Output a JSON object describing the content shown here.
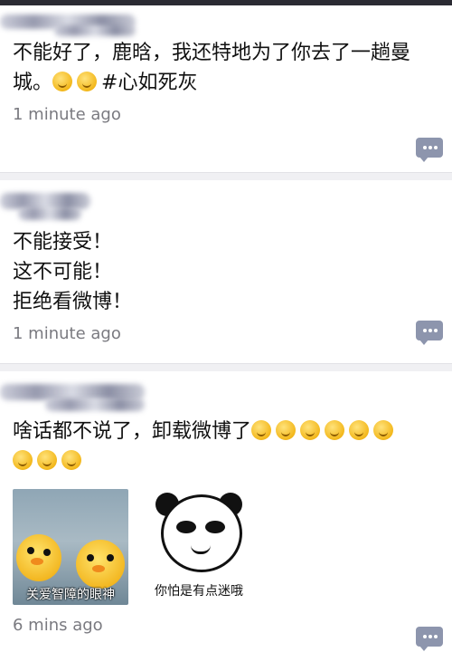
{
  "posts": [
    {
      "text": "不能好了，鹿晗，我还特地为了你去了一趟曼城。",
      "emoji_count": 2,
      "emoji_name": "thinking-face-icon",
      "hashtag": "#心如死灰",
      "time": "1 minute ago"
    },
    {
      "text": "不能接受！\n这不可能！\n拒绝看微博！",
      "time": "1 minute ago"
    },
    {
      "text": "啥话都不说了，卸载微博了",
      "emoji_count": 9,
      "emoji_name": "thinking-face-icon",
      "time": "6 mins ago",
      "images": [
        {
          "caption": "关爱智障的眼神",
          "icon": "yellow-ducks-image"
        },
        {
          "caption": "你怕是有点迷哦",
          "icon": "panda-meme-image"
        }
      ]
    }
  ],
  "colors": {
    "comment_button": "#8d95ad",
    "time_text": "#7a7a80",
    "divider": "#e2e2e6"
  }
}
